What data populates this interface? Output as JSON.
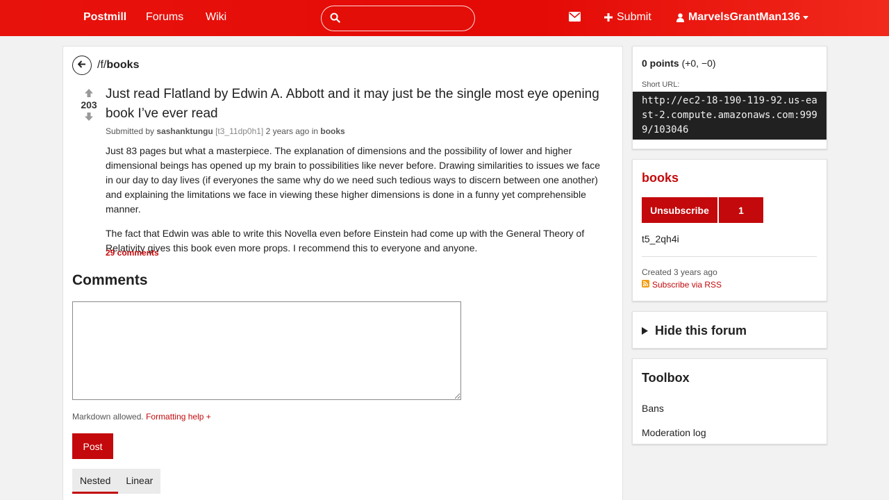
{
  "header": {
    "brand": "Postmill",
    "nav_forums": "Forums",
    "nav_wiki": "Wiki",
    "search_placeholder": "",
    "submit_label": "Submit",
    "username": "MarvelsGrantMan136",
    "accent": "#e40a06"
  },
  "breadcrumb": {
    "prefix": "/f/",
    "forum": "books"
  },
  "post": {
    "score": "203",
    "title": "Just read Flatland by Edwin A. Abbott and it may just be the single most eye opening book I’ve ever read",
    "meta_prefix": "Submitted by",
    "author": "sashanktungu",
    "author_id": "[t3_11dp0h1]",
    "age": "2 years ago",
    "in_label": "in",
    "forum": "books",
    "paragraph1": "Just 83 pages but what a masterpiece. The explanation of dimensions and the possibility of lower and higher dimensional beings has opened up my brain to possibilities like never before. Drawing similarities to issues we face in our day to day lives (if everyones the same why do we need such tedious ways to discern between one another) and explaining the limitations we face in viewing these higher dimensions is done in a funny yet comprehensible manner.",
    "paragraph2": "The fact that Edwin was able to write this Novella even before Einstein had come up with the General Theory of Relativity gives this book even more props. I recommend this to everyone and anyone.",
    "comments_link": "29 comments"
  },
  "comments": {
    "heading": "Comments",
    "reply_value": "",
    "markdown_note": "Markdown allowed.",
    "formatting_help": "Formatting help +",
    "post_button": "Post",
    "tab_nested": "Nested",
    "tab_linear": "Linear"
  },
  "sidebar": {
    "points_bold": "0 points",
    "points_detail": "(+0, −0)",
    "short_url_label": "Short URL:",
    "short_url": "http://ec2-18-190-119-92.us-east-2.compute.amazonaws.com:9999/103046",
    "forum_name": "books",
    "unsubscribe": "Unsubscribe",
    "subscriber_count": "1",
    "forum_id": "t5_2qh4i",
    "created_label": "Created",
    "created_age": "3 years ago",
    "rss": "Subscribe via RSS",
    "hide_forum": "Hide this forum",
    "toolbox": "Toolbox",
    "bans": "Bans",
    "moderation_log": "Moderation log",
    "brand_color": "#c3090b"
  }
}
